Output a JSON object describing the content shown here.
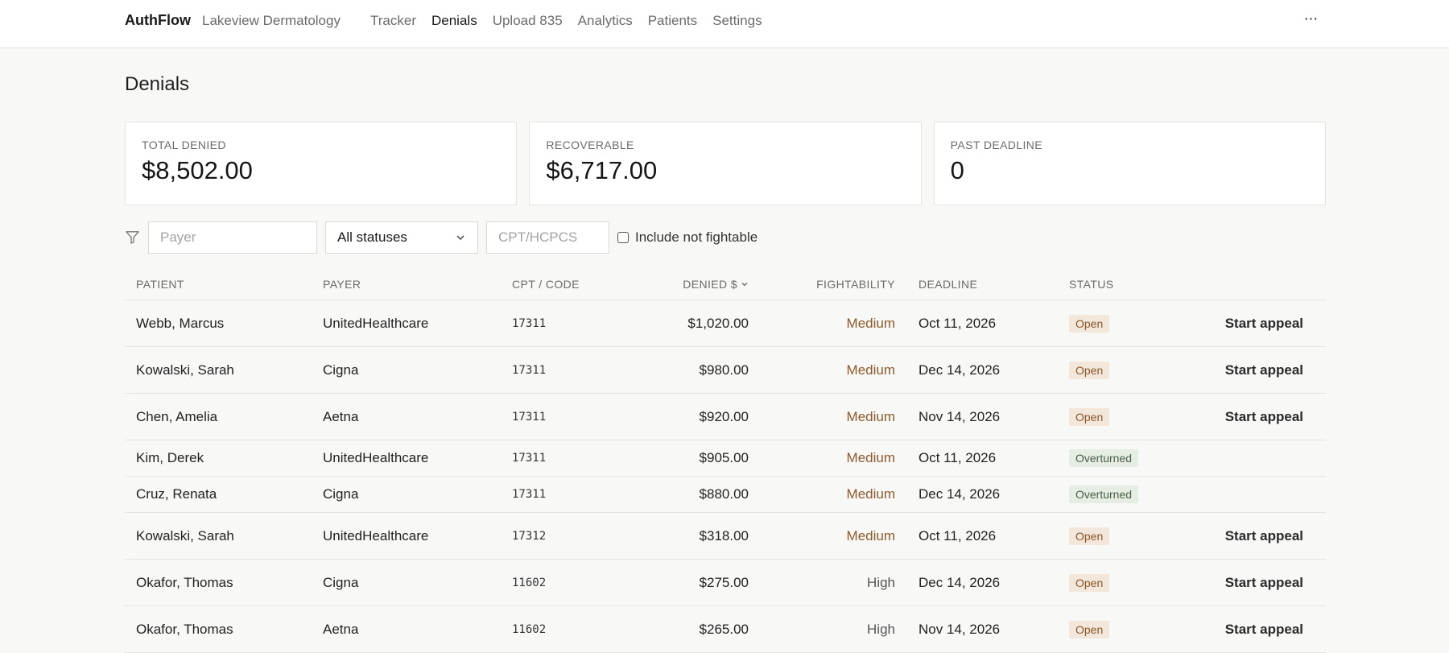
{
  "header": {
    "brand": "AuthFlow",
    "org": "Lakeview Dermatology",
    "nav": [
      "Tracker",
      "Denials",
      "Upload 835",
      "Analytics",
      "Patients",
      "Settings"
    ],
    "active": "Denials",
    "more_label": "···"
  },
  "page": {
    "title": "Denials"
  },
  "kpis": [
    {
      "label": "TOTAL DENIED",
      "value": "$8,502.00"
    },
    {
      "label": "RECOVERABLE",
      "value": "$6,717.00"
    },
    {
      "label": "PAST DEADLINE",
      "value": "0"
    }
  ],
  "filters": {
    "payer_placeholder": "Payer",
    "status_value": "All statuses",
    "cpt_placeholder": "CPT/HCPCS",
    "include_label": "Include not fightable"
  },
  "table": {
    "headers": {
      "patient": "PATIENT",
      "payer": "PAYER",
      "cpt": "CPT / CODE",
      "denied": "DENIED $",
      "fightability": "FIGHTABILITY",
      "deadline": "DEADLINE",
      "status": "STATUS"
    },
    "rows": [
      {
        "patient": "Webb, Marcus",
        "payer": "UnitedHealthcare",
        "cpt": "17311",
        "denied": "$1,020.00",
        "fightability": "Medium",
        "deadline": "Oct 11, 2026",
        "status": "Open",
        "action": "Start appeal"
      },
      {
        "patient": "Kowalski, Sarah",
        "payer": "Cigna",
        "cpt": "17311",
        "denied": "$980.00",
        "fightability": "Medium",
        "deadline": "Dec 14, 2026",
        "status": "Open",
        "action": "Start appeal"
      },
      {
        "patient": "Chen, Amelia",
        "payer": "Aetna",
        "cpt": "17311",
        "denied": "$920.00",
        "fightability": "Medium",
        "deadline": "Nov 14, 2026",
        "status": "Open",
        "action": "Start appeal"
      },
      {
        "patient": "Kim, Derek",
        "payer": "UnitedHealthcare",
        "cpt": "17311",
        "denied": "$905.00",
        "fightability": "Medium",
        "deadline": "Oct 11, 2026",
        "status": "Overturned",
        "action": ""
      },
      {
        "patient": "Cruz, Renata",
        "payer": "Cigna",
        "cpt": "17311",
        "denied": "$880.00",
        "fightability": "Medium",
        "deadline": "Dec 14, 2026",
        "status": "Overturned",
        "action": ""
      },
      {
        "patient": "Kowalski, Sarah",
        "payer": "UnitedHealthcare",
        "cpt": "17312",
        "denied": "$318.00",
        "fightability": "Medium",
        "deadline": "Oct 11, 2026",
        "status": "Open",
        "action": "Start appeal"
      },
      {
        "patient": "Okafor, Thomas",
        "payer": "Cigna",
        "cpt": "11602",
        "denied": "$275.00",
        "fightability": "High",
        "deadline": "Dec 14, 2026",
        "status": "Open",
        "action": "Start appeal"
      },
      {
        "patient": "Okafor, Thomas",
        "payer": "Aetna",
        "cpt": "11602",
        "denied": "$265.00",
        "fightability": "High",
        "deadline": "Nov 14, 2026",
        "status": "Open",
        "action": "Start appeal"
      }
    ]
  }
}
